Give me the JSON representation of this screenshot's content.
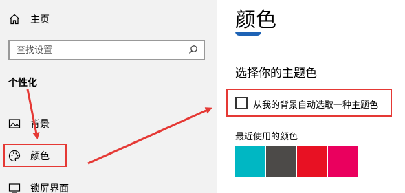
{
  "sidebar": {
    "home_label": "主页",
    "search_placeholder": "查找设置",
    "section_title": "个性化",
    "items": [
      {
        "label": "背景",
        "icon": "picture-icon"
      },
      {
        "label": "颜色",
        "icon": "palette-icon"
      },
      {
        "label": "锁屏界面",
        "icon": "monitor-icon"
      }
    ]
  },
  "main": {
    "title": "颜色",
    "choose_heading": "选择你的主题色",
    "auto_accent_label": "从我的背景自动选取一种主题色",
    "recent_colors_label": "最近使用的颜色",
    "recent_colors": [
      "#00b7c3",
      "#4c4a48",
      "#e81123",
      "#ea005e"
    ]
  },
  "annotation": {
    "color": "#e53935"
  }
}
